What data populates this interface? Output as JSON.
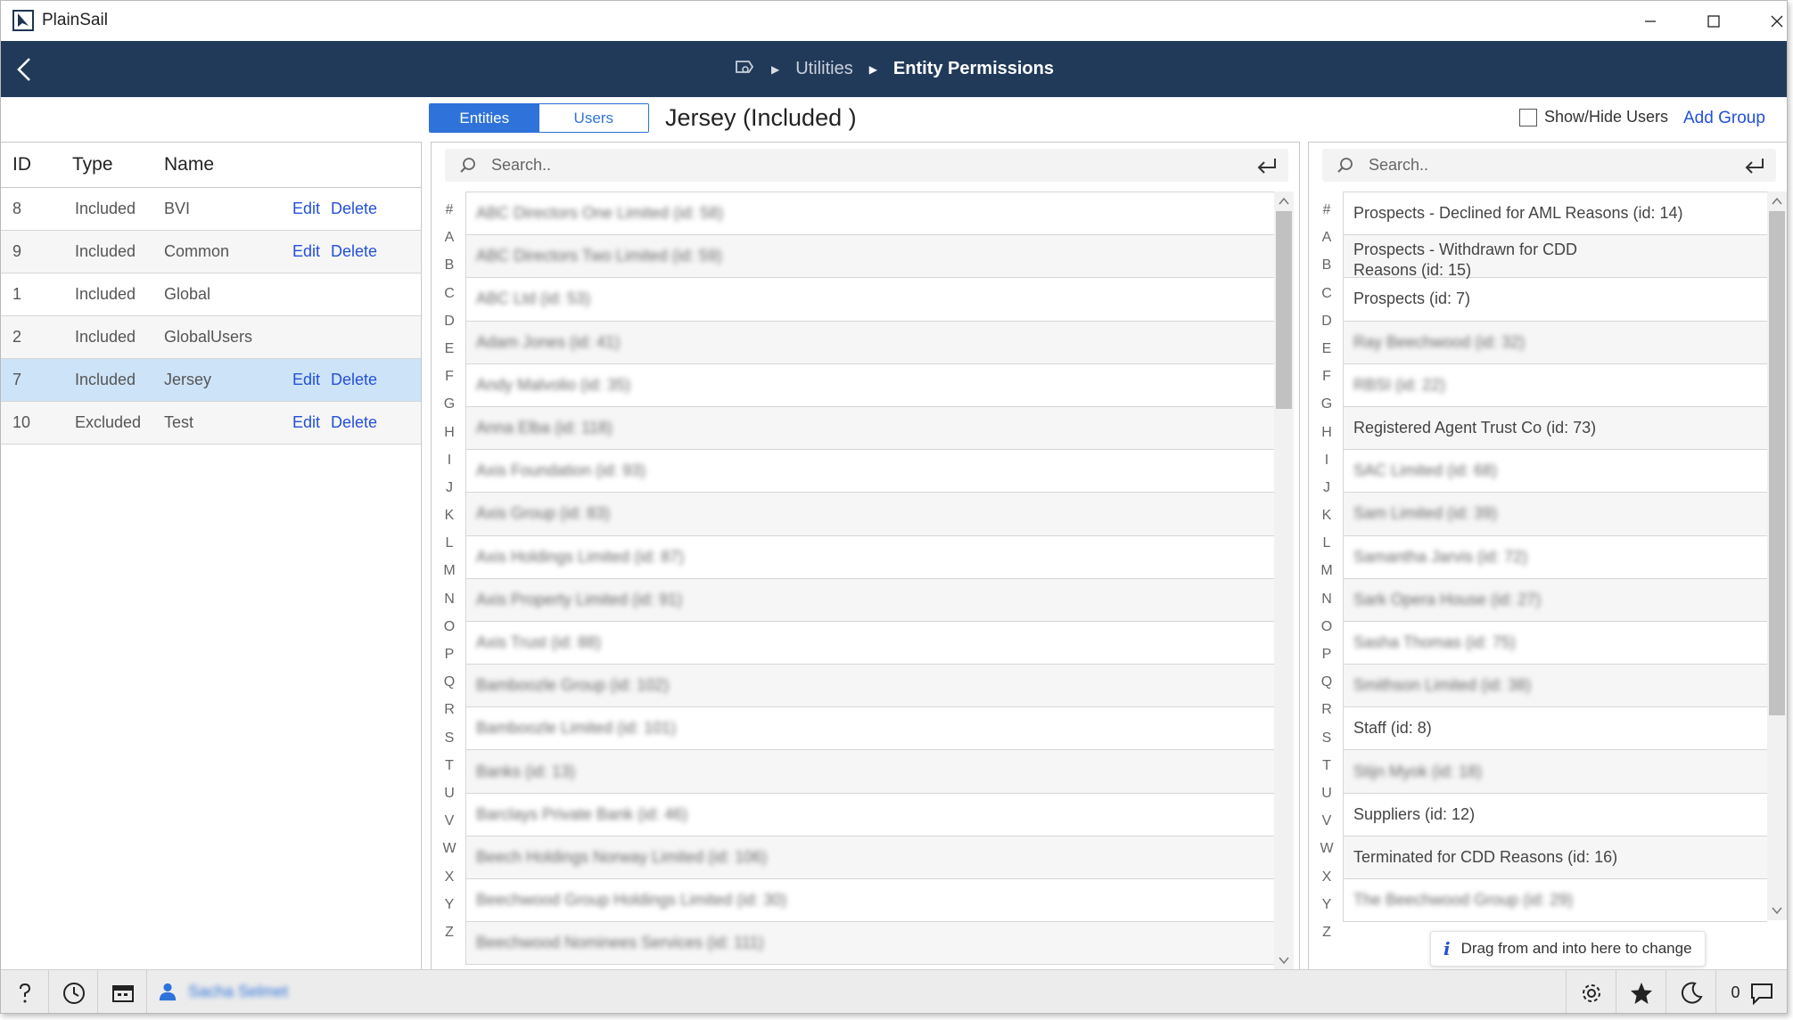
{
  "app": {
    "title": "PlainSail"
  },
  "breadcrumb": {
    "items": [
      "Utilities",
      "Entity Permissions"
    ]
  },
  "toolbar": {
    "tabs": [
      {
        "label": "Entities",
        "active": true
      },
      {
        "label": "Users",
        "active": false
      }
    ],
    "group_heading": "Jersey (Included )",
    "show_hide_label": "Show/Hide Users",
    "show_hide_checked": false,
    "add_group_label": "Add Group"
  },
  "groups": {
    "columns": [
      "ID",
      "Type",
      "Name"
    ],
    "edit_label": "Edit",
    "delete_label": "Delete",
    "rows": [
      {
        "id": "8",
        "type": "Included",
        "name": "BVI",
        "editable": true
      },
      {
        "id": "9",
        "type": "Included",
        "name": "Common",
        "editable": true
      },
      {
        "id": "1",
        "type": "Included",
        "name": "Global",
        "editable": false
      },
      {
        "id": "2",
        "type": "Included",
        "name": "GlobalUsers",
        "editable": false
      },
      {
        "id": "7",
        "type": "Included",
        "name": "Jersey",
        "editable": true,
        "selected": true
      },
      {
        "id": "10",
        "type": "Excluded",
        "name": "Test",
        "editable": true
      }
    ]
  },
  "alphabet": [
    "#",
    "A",
    "B",
    "C",
    "D",
    "E",
    "F",
    "G",
    "H",
    "I",
    "J",
    "K",
    "L",
    "M",
    "N",
    "O",
    "P",
    "Q",
    "R",
    "S",
    "T",
    "U",
    "V",
    "W",
    "X",
    "Y",
    "Z"
  ],
  "search": {
    "placeholder": "Search.."
  },
  "available_list": {
    "items": [
      {
        "text": "ABC Directors One Limited (id: 58)",
        "blurred": true
      },
      {
        "text": "ABC Directors Two Limited (id: 59)",
        "blurred": true
      },
      {
        "text": "ABC Ltd (id: 53)",
        "blurred": true
      },
      {
        "text": "Adam Jones (id: 41)",
        "blurred": true
      },
      {
        "text": "Andy Malvolio (id: 35)",
        "blurred": true
      },
      {
        "text": "Anna Elba (id: 118)",
        "blurred": true
      },
      {
        "text": "Axis Foundation (id: 93)",
        "blurred": true
      },
      {
        "text": "Axis Group (id: 83)",
        "blurred": true
      },
      {
        "text": "Axis Holdings Limited (id: 87)",
        "blurred": true
      },
      {
        "text": "Axis Property Limited (id: 91)",
        "blurred": true
      },
      {
        "text": "Axis Trust (id: 88)",
        "blurred": true
      },
      {
        "text": "Bamboozle Group (id: 102)",
        "blurred": true
      },
      {
        "text": "Bamboozle Limited (id: 101)",
        "blurred": true
      },
      {
        "text": "Banks (id: 13)",
        "blurred": true
      },
      {
        "text": "Barclays Private Bank (id: 46)",
        "blurred": true
      },
      {
        "text": "Beech Holdings Norway Limited (id: 106)",
        "blurred": true
      },
      {
        "text": "Beechwood Group Holdings Limited (id: 30)",
        "blurred": true
      },
      {
        "text": "Beechwood Nominees Services (id: 111)",
        "blurred": true
      }
    ]
  },
  "assigned_list": {
    "items": [
      {
        "text": "Prospects - Declined for AML Reasons (id: 14)",
        "blurred": false
      },
      {
        "text": "Prospects - Withdrawn for CDD Reasons (id: 15)",
        "blurred": false,
        "wrap": true
      },
      {
        "text": "Prospects (id: 7)",
        "blurred": false
      },
      {
        "text": "Ray Beechwood (id: 32)",
        "blurred": true
      },
      {
        "text": "RBSI (id: 22)",
        "blurred": true
      },
      {
        "text": "Registered Agent Trust Co (id: 73)",
        "blurred": false
      },
      {
        "text": "SAC Limited (id: 68)",
        "blurred": true
      },
      {
        "text": "Sam Limited (id: 39)",
        "blurred": true
      },
      {
        "text": "Samantha Jarvis (id: 72)",
        "blurred": true
      },
      {
        "text": "Sark Opera House (id: 27)",
        "blurred": true
      },
      {
        "text": "Sasha Thomas (id: 75)",
        "blurred": true
      },
      {
        "text": "Smithson Limited (id: 38)",
        "blurred": true
      },
      {
        "text": "Staff (id: 8)",
        "blurred": false
      },
      {
        "text": "Stijn Myok (id: 18)",
        "blurred": true
      },
      {
        "text": "Suppliers (id: 12)",
        "blurred": false
      },
      {
        "text": "Terminated for CDD Reasons (id: 16)",
        "blurred": false
      },
      {
        "text": "The Beechwood Group (id: 29)",
        "blurred": true
      }
    ]
  },
  "hint": {
    "text": "Drag from and into here to change"
  },
  "statusbar": {
    "user_name": "Sacha Selmet",
    "notification_count": "0"
  },
  "icons": [
    "app-logo-icon",
    "minimize-icon",
    "maximize-icon",
    "close-icon",
    "back-arrow-icon",
    "home-icon",
    "search-icon",
    "enter-icon",
    "info-icon",
    "help-icon",
    "clock-icon",
    "calendar-icon",
    "user-icon",
    "gear-icon",
    "star-icon",
    "moon-icon",
    "chat-icon"
  ],
  "colors": {
    "navbar": "#223a5a",
    "accent": "#2f73da",
    "link": "#2450d8",
    "selected_row": "#cde3f8"
  }
}
